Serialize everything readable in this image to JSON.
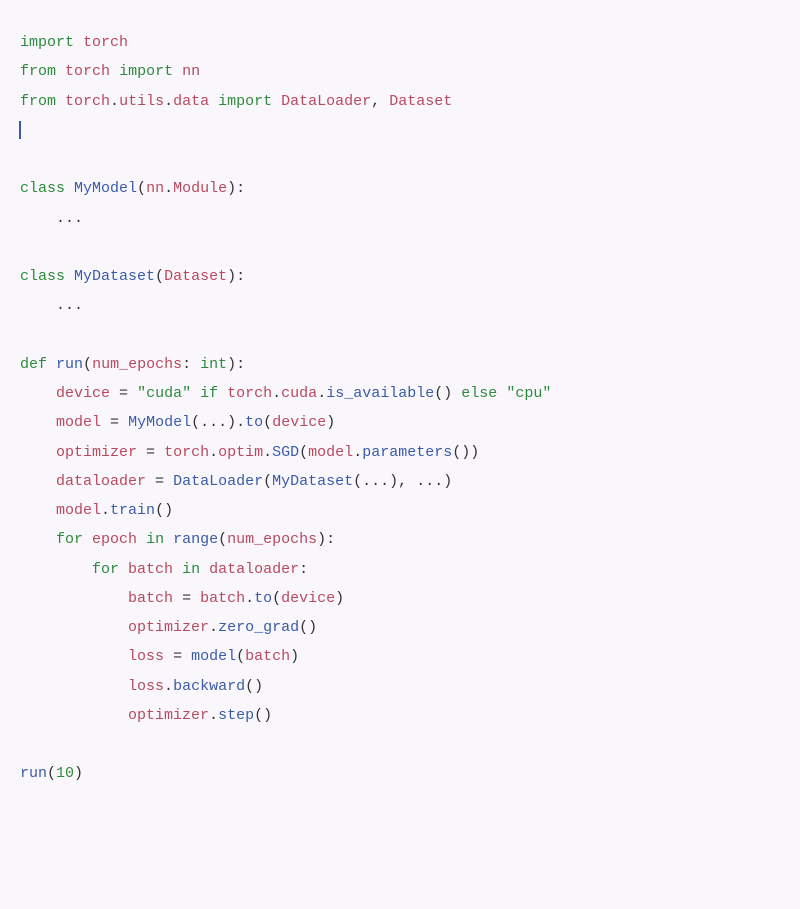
{
  "code": {
    "lines": [
      {
        "type": "import",
        "tokens": [
          {
            "t": "import",
            "c": "kw"
          },
          {
            "t": " ",
            "c": ""
          },
          {
            "t": "torch",
            "c": "mod"
          }
        ]
      },
      {
        "type": "from_import",
        "tokens": [
          {
            "t": "from",
            "c": "kw"
          },
          {
            "t": " ",
            "c": ""
          },
          {
            "t": "torch",
            "c": "mod"
          },
          {
            "t": " ",
            "c": ""
          },
          {
            "t": "import",
            "c": "kw"
          },
          {
            "t": " ",
            "c": ""
          },
          {
            "t": "nn",
            "c": "mod"
          }
        ]
      },
      {
        "type": "from_import",
        "tokens": [
          {
            "t": "from",
            "c": "kw"
          },
          {
            "t": " ",
            "c": ""
          },
          {
            "t": "torch",
            "c": "mod"
          },
          {
            "t": ".",
            "c": "dot"
          },
          {
            "t": "utils",
            "c": "mod"
          },
          {
            "t": ".",
            "c": "dot"
          },
          {
            "t": "data",
            "c": "mod"
          },
          {
            "t": " ",
            "c": ""
          },
          {
            "t": "import",
            "c": "kw"
          },
          {
            "t": " ",
            "c": ""
          },
          {
            "t": "DataLoader",
            "c": "mod"
          },
          {
            "t": ",",
            "c": "comma"
          },
          {
            "t": " ",
            "c": ""
          },
          {
            "t": "Dataset",
            "c": "mod"
          }
        ]
      },
      {
        "type": "cursor",
        "tokens": []
      },
      {
        "type": "blank",
        "tokens": []
      },
      {
        "type": "class_def",
        "tokens": [
          {
            "t": "class",
            "c": "kw"
          },
          {
            "t": " ",
            "c": ""
          },
          {
            "t": "MyModel",
            "c": "cls"
          },
          {
            "t": "(",
            "c": "paren"
          },
          {
            "t": "nn",
            "c": "mod"
          },
          {
            "t": ".",
            "c": "dot"
          },
          {
            "t": "Module",
            "c": "mod"
          },
          {
            "t": ")",
            "c": "paren"
          },
          {
            "t": ":",
            "c": "op"
          }
        ]
      },
      {
        "type": "body",
        "indent": 1,
        "tokens": [
          {
            "t": "...",
            "c": "ellipsis"
          }
        ]
      },
      {
        "type": "blank",
        "tokens": []
      },
      {
        "type": "class_def",
        "tokens": [
          {
            "t": "class",
            "c": "kw"
          },
          {
            "t": " ",
            "c": ""
          },
          {
            "t": "MyDataset",
            "c": "cls"
          },
          {
            "t": "(",
            "c": "paren"
          },
          {
            "t": "Dataset",
            "c": "mod"
          },
          {
            "t": ")",
            "c": "paren"
          },
          {
            "t": ":",
            "c": "op"
          }
        ]
      },
      {
        "type": "body",
        "indent": 1,
        "tokens": [
          {
            "t": "...",
            "c": "ellipsis"
          }
        ]
      },
      {
        "type": "blank",
        "tokens": []
      },
      {
        "type": "func_def",
        "tokens": [
          {
            "t": "def",
            "c": "kw"
          },
          {
            "t": " ",
            "c": ""
          },
          {
            "t": "run",
            "c": "cls"
          },
          {
            "t": "(",
            "c": "paren"
          },
          {
            "t": "num_epochs",
            "c": "mod"
          },
          {
            "t": ":",
            "c": "op"
          },
          {
            "t": " ",
            "c": ""
          },
          {
            "t": "int",
            "c": "int-type"
          },
          {
            "t": ")",
            "c": "paren"
          },
          {
            "t": ":",
            "c": "op"
          }
        ]
      },
      {
        "type": "stmt",
        "indent": 1,
        "tokens": [
          {
            "t": "device",
            "c": "mod"
          },
          {
            "t": " ",
            "c": ""
          },
          {
            "t": "=",
            "c": "op"
          },
          {
            "t": " ",
            "c": ""
          },
          {
            "t": "\"cuda\"",
            "c": "str"
          },
          {
            "t": " ",
            "c": ""
          },
          {
            "t": "if",
            "c": "kw"
          },
          {
            "t": " ",
            "c": ""
          },
          {
            "t": "torch",
            "c": "mod"
          },
          {
            "t": ".",
            "c": "dot"
          },
          {
            "t": "cuda",
            "c": "mod"
          },
          {
            "t": ".",
            "c": "dot"
          },
          {
            "t": "is_available",
            "c": "cls"
          },
          {
            "t": "(",
            "c": "paren"
          },
          {
            "t": ")",
            "c": "paren"
          },
          {
            "t": " ",
            "c": ""
          },
          {
            "t": "else",
            "c": "kw"
          },
          {
            "t": " ",
            "c": ""
          },
          {
            "t": "\"cpu\"",
            "c": "str"
          }
        ]
      },
      {
        "type": "stmt",
        "indent": 1,
        "tokens": [
          {
            "t": "model",
            "c": "mod"
          },
          {
            "t": " ",
            "c": ""
          },
          {
            "t": "=",
            "c": "op"
          },
          {
            "t": " ",
            "c": ""
          },
          {
            "t": "MyModel",
            "c": "cls"
          },
          {
            "t": "(",
            "c": "paren"
          },
          {
            "t": "...",
            "c": "ellipsis"
          },
          {
            "t": ")",
            "c": "paren"
          },
          {
            "t": ".",
            "c": "dot"
          },
          {
            "t": "to",
            "c": "cls"
          },
          {
            "t": "(",
            "c": "paren"
          },
          {
            "t": "device",
            "c": "mod"
          },
          {
            "t": ")",
            "c": "paren"
          }
        ]
      },
      {
        "type": "stmt",
        "indent": 1,
        "tokens": [
          {
            "t": "optimizer",
            "c": "mod"
          },
          {
            "t": " ",
            "c": ""
          },
          {
            "t": "=",
            "c": "op"
          },
          {
            "t": " ",
            "c": ""
          },
          {
            "t": "torch",
            "c": "mod"
          },
          {
            "t": ".",
            "c": "dot"
          },
          {
            "t": "optim",
            "c": "mod"
          },
          {
            "t": ".",
            "c": "dot"
          },
          {
            "t": "SGD",
            "c": "cls"
          },
          {
            "t": "(",
            "c": "paren"
          },
          {
            "t": "model",
            "c": "mod"
          },
          {
            "t": ".",
            "c": "dot"
          },
          {
            "t": "parameters",
            "c": "cls"
          },
          {
            "t": "(",
            "c": "paren"
          },
          {
            "t": ")",
            "c": "paren"
          },
          {
            "t": ")",
            "c": "paren"
          }
        ]
      },
      {
        "type": "stmt",
        "indent": 1,
        "tokens": [
          {
            "t": "dataloader",
            "c": "mod"
          },
          {
            "t": " ",
            "c": ""
          },
          {
            "t": "=",
            "c": "op"
          },
          {
            "t": " ",
            "c": ""
          },
          {
            "t": "DataLoader",
            "c": "cls"
          },
          {
            "t": "(",
            "c": "paren"
          },
          {
            "t": "MyDataset",
            "c": "cls"
          },
          {
            "t": "(",
            "c": "paren"
          },
          {
            "t": "...",
            "c": "ellipsis"
          },
          {
            "t": ")",
            "c": "paren"
          },
          {
            "t": ",",
            "c": "comma"
          },
          {
            "t": " ",
            "c": ""
          },
          {
            "t": "...",
            "c": "ellipsis"
          },
          {
            "t": ")",
            "c": "paren"
          }
        ]
      },
      {
        "type": "stmt",
        "indent": 1,
        "tokens": [
          {
            "t": "model",
            "c": "mod"
          },
          {
            "t": ".",
            "c": "dot"
          },
          {
            "t": "train",
            "c": "cls"
          },
          {
            "t": "(",
            "c": "paren"
          },
          {
            "t": ")",
            "c": "paren"
          }
        ]
      },
      {
        "type": "for",
        "indent": 1,
        "tokens": [
          {
            "t": "for",
            "c": "kw"
          },
          {
            "t": " ",
            "c": ""
          },
          {
            "t": "epoch",
            "c": "mod"
          },
          {
            "t": " ",
            "c": ""
          },
          {
            "t": "in",
            "c": "kw"
          },
          {
            "t": " ",
            "c": ""
          },
          {
            "t": "range",
            "c": "cls"
          },
          {
            "t": "(",
            "c": "paren"
          },
          {
            "t": "num_epochs",
            "c": "mod"
          },
          {
            "t": ")",
            "c": "paren"
          },
          {
            "t": ":",
            "c": "op"
          }
        ]
      },
      {
        "type": "for",
        "indent": 2,
        "tokens": [
          {
            "t": "for",
            "c": "kw"
          },
          {
            "t": " ",
            "c": ""
          },
          {
            "t": "batch",
            "c": "mod"
          },
          {
            "t": " ",
            "c": ""
          },
          {
            "t": "in",
            "c": "kw"
          },
          {
            "t": " ",
            "c": ""
          },
          {
            "t": "dataloader",
            "c": "mod"
          },
          {
            "t": ":",
            "c": "op"
          }
        ]
      },
      {
        "type": "stmt",
        "indent": 3,
        "tokens": [
          {
            "t": "batch",
            "c": "mod"
          },
          {
            "t": " ",
            "c": ""
          },
          {
            "t": "=",
            "c": "op"
          },
          {
            "t": " ",
            "c": ""
          },
          {
            "t": "batch",
            "c": "mod"
          },
          {
            "t": ".",
            "c": "dot"
          },
          {
            "t": "to",
            "c": "cls"
          },
          {
            "t": "(",
            "c": "paren"
          },
          {
            "t": "device",
            "c": "mod"
          },
          {
            "t": ")",
            "c": "paren"
          }
        ]
      },
      {
        "type": "stmt",
        "indent": 3,
        "tokens": [
          {
            "t": "optimizer",
            "c": "mod"
          },
          {
            "t": ".",
            "c": "dot"
          },
          {
            "t": "zero_grad",
            "c": "cls"
          },
          {
            "t": "(",
            "c": "paren"
          },
          {
            "t": ")",
            "c": "paren"
          }
        ]
      },
      {
        "type": "stmt",
        "indent": 3,
        "tokens": [
          {
            "t": "loss",
            "c": "mod"
          },
          {
            "t": " ",
            "c": ""
          },
          {
            "t": "=",
            "c": "op"
          },
          {
            "t": " ",
            "c": ""
          },
          {
            "t": "model",
            "c": "cls"
          },
          {
            "t": "(",
            "c": "paren"
          },
          {
            "t": "batch",
            "c": "mod"
          },
          {
            "t": ")",
            "c": "paren"
          }
        ]
      },
      {
        "type": "stmt",
        "indent": 3,
        "tokens": [
          {
            "t": "loss",
            "c": "mod"
          },
          {
            "t": ".",
            "c": "dot"
          },
          {
            "t": "backward",
            "c": "cls"
          },
          {
            "t": "(",
            "c": "paren"
          },
          {
            "t": ")",
            "c": "paren"
          }
        ]
      },
      {
        "type": "stmt",
        "indent": 3,
        "tokens": [
          {
            "t": "optimizer",
            "c": "mod"
          },
          {
            "t": ".",
            "c": "dot"
          },
          {
            "t": "step",
            "c": "cls"
          },
          {
            "t": "(",
            "c": "paren"
          },
          {
            "t": ")",
            "c": "paren"
          }
        ]
      },
      {
        "type": "blank",
        "tokens": []
      },
      {
        "type": "call",
        "tokens": [
          {
            "t": "run",
            "c": "cls"
          },
          {
            "t": "(",
            "c": "paren"
          },
          {
            "t": "10",
            "c": "num"
          },
          {
            "t": ")",
            "c": "paren"
          }
        ]
      }
    ]
  },
  "indent_unit": "    "
}
